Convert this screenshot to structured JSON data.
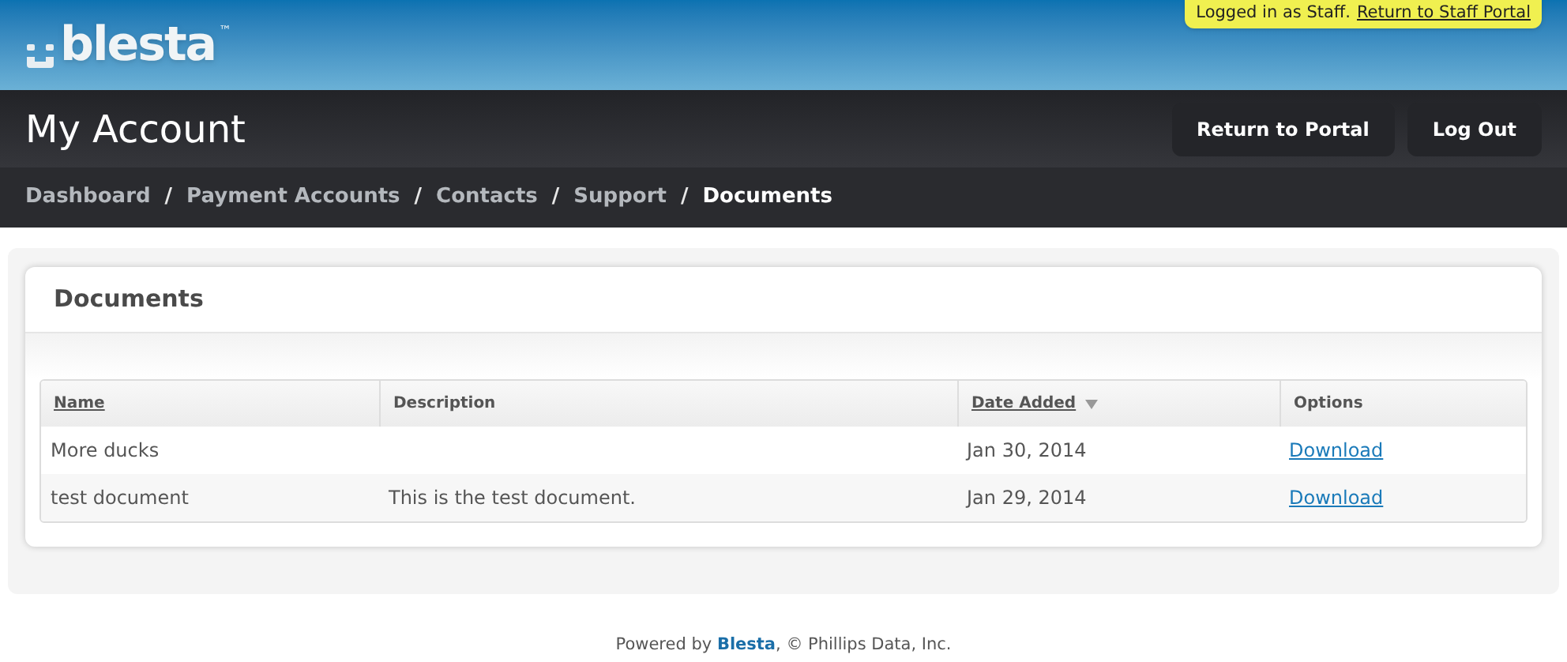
{
  "logo": {
    "text": "blesta",
    "mark": "™"
  },
  "staff_notice": {
    "text": "Logged in as Staff.",
    "link": "Return to Staff Portal"
  },
  "header": {
    "title": "My Account",
    "buttons": [
      "Return to Portal",
      "Log Out"
    ]
  },
  "nav": [
    {
      "label": "Dashboard",
      "selected": false,
      "separator_after": "/"
    },
    {
      "label": "Payment Accounts",
      "selected": false,
      "separator_after": "/"
    },
    {
      "label": "Contacts",
      "selected": false,
      "separator_after": "/"
    },
    {
      "label": "Support",
      "selected": false,
      "separator_after": "/"
    },
    {
      "label": "Documents",
      "selected": true
    }
  ],
  "panel": {
    "title": "Documents"
  },
  "table": {
    "columns": [
      {
        "label": "Name",
        "sortable": true,
        "sorted": false
      },
      {
        "label": "Description",
        "sortable": false,
        "sorted": false
      },
      {
        "label": "Date Added",
        "sortable": true,
        "sorted": true
      },
      {
        "label": "Options",
        "sortable": false,
        "sorted": false
      }
    ],
    "rows": [
      {
        "name": "More ducks",
        "date": "Jan 30, 2014",
        "action": "Download"
      },
      {
        "name": "test document",
        "description": "This is the test document.",
        "date": "Jan 29, 2014",
        "action": "Download"
      }
    ]
  },
  "footer": {
    "before": "Powered by",
    "link": "Blesta",
    "after": ", © Phillips Data, Inc."
  }
}
